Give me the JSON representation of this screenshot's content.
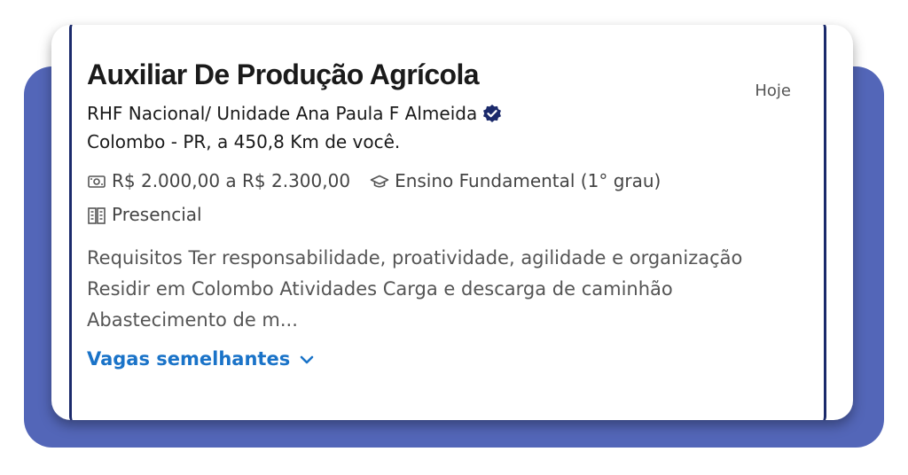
{
  "job": {
    "title": "Auxiliar De Produção Agrícola",
    "posted": "Hoje",
    "company": "RHF Nacional/ Unidade Ana Paula F Almeida",
    "verified_icon": "verified-check-icon",
    "location": "Colombo - PR, a 450,8 Km de você.",
    "salary": "R$ 2.000,00 a R$ 2.300,00",
    "salary_icon": "money-icon",
    "education": "Ensino Fundamental (1° grau)",
    "education_icon": "graduation-cap-icon",
    "work_mode": "Presencial",
    "work_mode_icon": "building-icon",
    "description": "Requisitos  Ter responsabilidade, proatividade, agilidade e organização Residir em Colombo  Atividades Carga e descarga de caminhão Abastecimento de m...",
    "similar_link": "Vagas semelhantes",
    "similar_icon": "chevron-down-icon"
  },
  "colors": {
    "backdrop": "#5366b8",
    "card_border": "#1b2a6b",
    "link": "#1a73c8",
    "verified": "#1b2a6b"
  }
}
